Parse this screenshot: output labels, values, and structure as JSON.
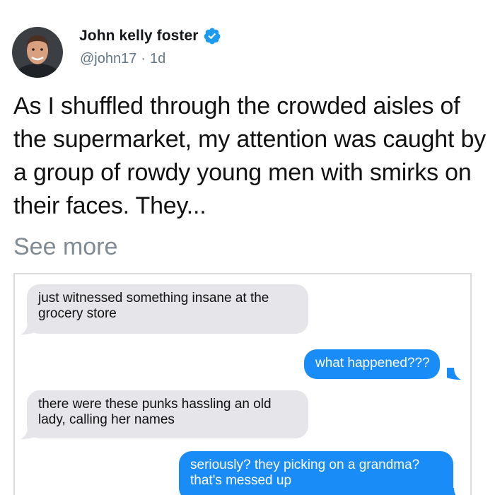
{
  "post": {
    "author": {
      "display_name": "John kelly foster",
      "handle": "@john17",
      "separator": "·",
      "time": "1d",
      "verified": true,
      "avatar_icon": "profile-photo"
    },
    "text": "As I shuffled through the crowded aisles of the supermarket, my attention was caught by a group of rowdy young men with smirks on their faces. They...",
    "see_more_label": "See more"
  },
  "screenshot": {
    "messages": [
      {
        "direction": "incoming",
        "text": "just witnessed something insane at the grocery store"
      },
      {
        "direction": "outgoing",
        "text": "what happened???"
      },
      {
        "direction": "incoming",
        "text": "there were these punks hassling an old lady, calling her names"
      },
      {
        "direction": "outgoing",
        "text": "seriously? they picking on a grandma? that's messed up"
      }
    ]
  },
  "colors": {
    "verified": "#1d9bf0",
    "outgoing_bubble": "#1a8cf8",
    "incoming_bubble": "#e5e5ea",
    "muted_text": "#657786"
  }
}
